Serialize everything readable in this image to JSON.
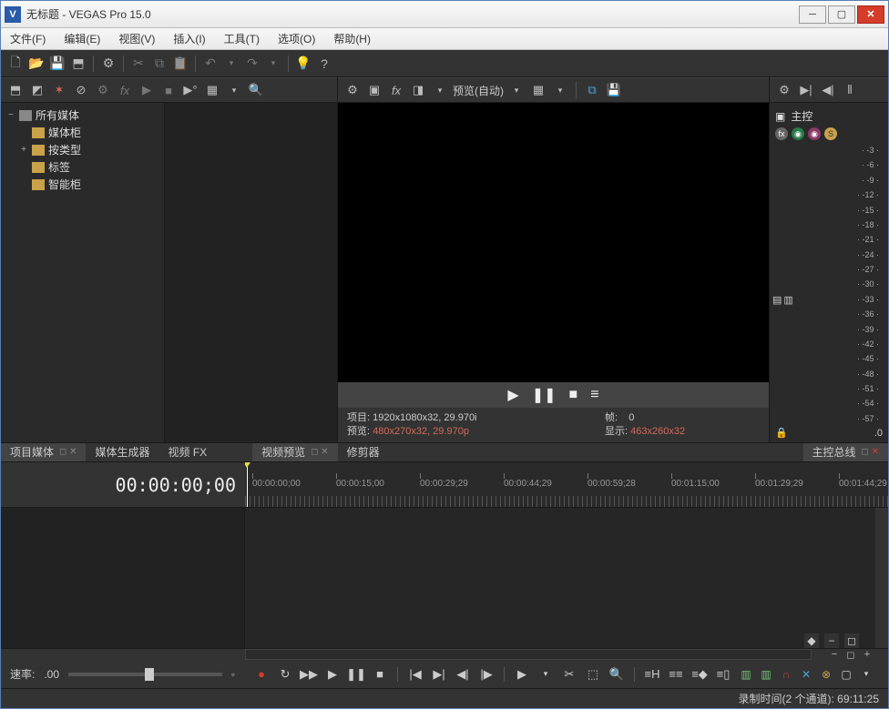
{
  "window": {
    "title": "无标题 - VEGAS Pro 15.0",
    "logo": "V"
  },
  "menubar": [
    "文件(F)",
    "编辑(E)",
    "视图(V)",
    "插入(I)",
    "工具(T)",
    "选项(O)",
    "帮助(H)"
  ],
  "preview": {
    "dropdown": "预览(自动)",
    "status": {
      "project_label": "项目:",
      "project_val": "1920x1080x32, 29.970i",
      "preview_label": "预览:",
      "preview_val": "480x270x32, 29.970p",
      "frame_label": "帧:",
      "frame_val": "0",
      "display_label": "显示:",
      "display_val": "463x260x32"
    }
  },
  "media_tree": {
    "root": "所有媒体",
    "items": [
      "媒体柜",
      "按类型",
      "标签",
      "智能柜"
    ]
  },
  "master": {
    "title": "主控",
    "scale": [
      "3",
      "6",
      "9",
      "12",
      "15",
      "18",
      "21",
      "24",
      "27",
      "30",
      "33",
      "36",
      "39",
      "42",
      "45",
      "48",
      "51",
      "54",
      "57"
    ],
    "bottom_val": ".0"
  },
  "tabs_left": [
    {
      "label": "项目媒体",
      "active": true,
      "pinned": true
    },
    {
      "label": "媒体生成器",
      "active": false
    },
    {
      "label": "视频 FX",
      "active": false
    }
  ],
  "tabs_mid": [
    {
      "label": "视频预览",
      "active": true,
      "pinned": true
    },
    {
      "label": "修剪器",
      "active": false
    }
  ],
  "tabs_right": [
    {
      "label": "主控总线",
      "active": true,
      "pinned": true
    }
  ],
  "timecode": "00:00:00;00",
  "ruler": [
    {
      "pos": 8,
      "label": "00:00:00;00"
    },
    {
      "pos": 100,
      "label": "00:00:15;00"
    },
    {
      "pos": 192,
      "label": "00:00:29;29"
    },
    {
      "pos": 284,
      "label": "00:00:44;29"
    },
    {
      "pos": 376,
      "label": "00:00:59;28"
    },
    {
      "pos": 468,
      "label": "00:01:15;00"
    },
    {
      "pos": 560,
      "label": "00:01:29;29"
    },
    {
      "pos": 652,
      "label": "00:01:44;29"
    }
  ],
  "rate": {
    "label": "速率:",
    "value": ".00"
  },
  "status": "录制时间(2 个通道): 69:11:25"
}
